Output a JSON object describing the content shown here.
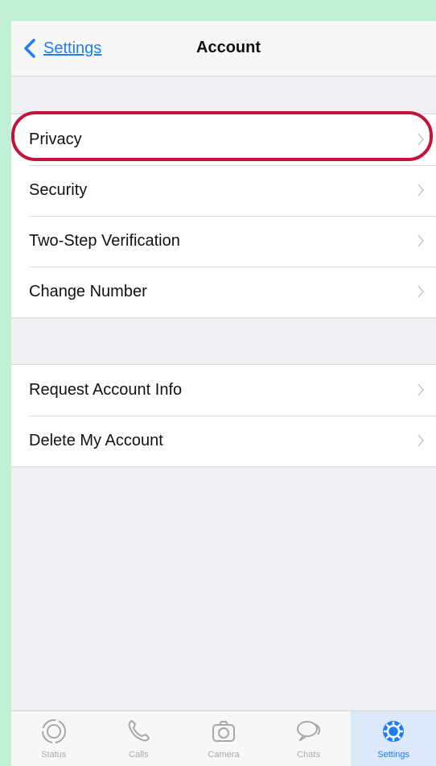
{
  "nav": {
    "back_label": "Settings",
    "title": "Account"
  },
  "sections": [
    {
      "rows": [
        {
          "label": "Privacy",
          "icon": "chevron-right-icon"
        },
        {
          "label": "Security",
          "icon": "chevron-right-icon"
        },
        {
          "label": "Two-Step Verification",
          "icon": "chevron-right-icon"
        },
        {
          "label": "Change Number",
          "icon": "chevron-right-icon"
        }
      ]
    },
    {
      "rows": [
        {
          "label": "Request Account Info",
          "icon": "chevron-right-icon"
        },
        {
          "label": "Delete My Account",
          "icon": "chevron-right-icon"
        }
      ]
    }
  ],
  "highlight": {
    "target": "Privacy",
    "color": "#c0143c"
  },
  "tabbar": {
    "active": "Settings",
    "tabs": [
      {
        "label": "Status",
        "icon": "status-icon"
      },
      {
        "label": "Calls",
        "icon": "phone-icon"
      },
      {
        "label": "Camera",
        "icon": "camera-icon"
      },
      {
        "label": "Chats",
        "icon": "chat-bubbles-icon"
      },
      {
        "label": "Settings",
        "icon": "gear-icon"
      }
    ]
  },
  "colors": {
    "accent": "#1e7cf5",
    "background": "#bff0d6",
    "highlight": "#c0143c"
  }
}
